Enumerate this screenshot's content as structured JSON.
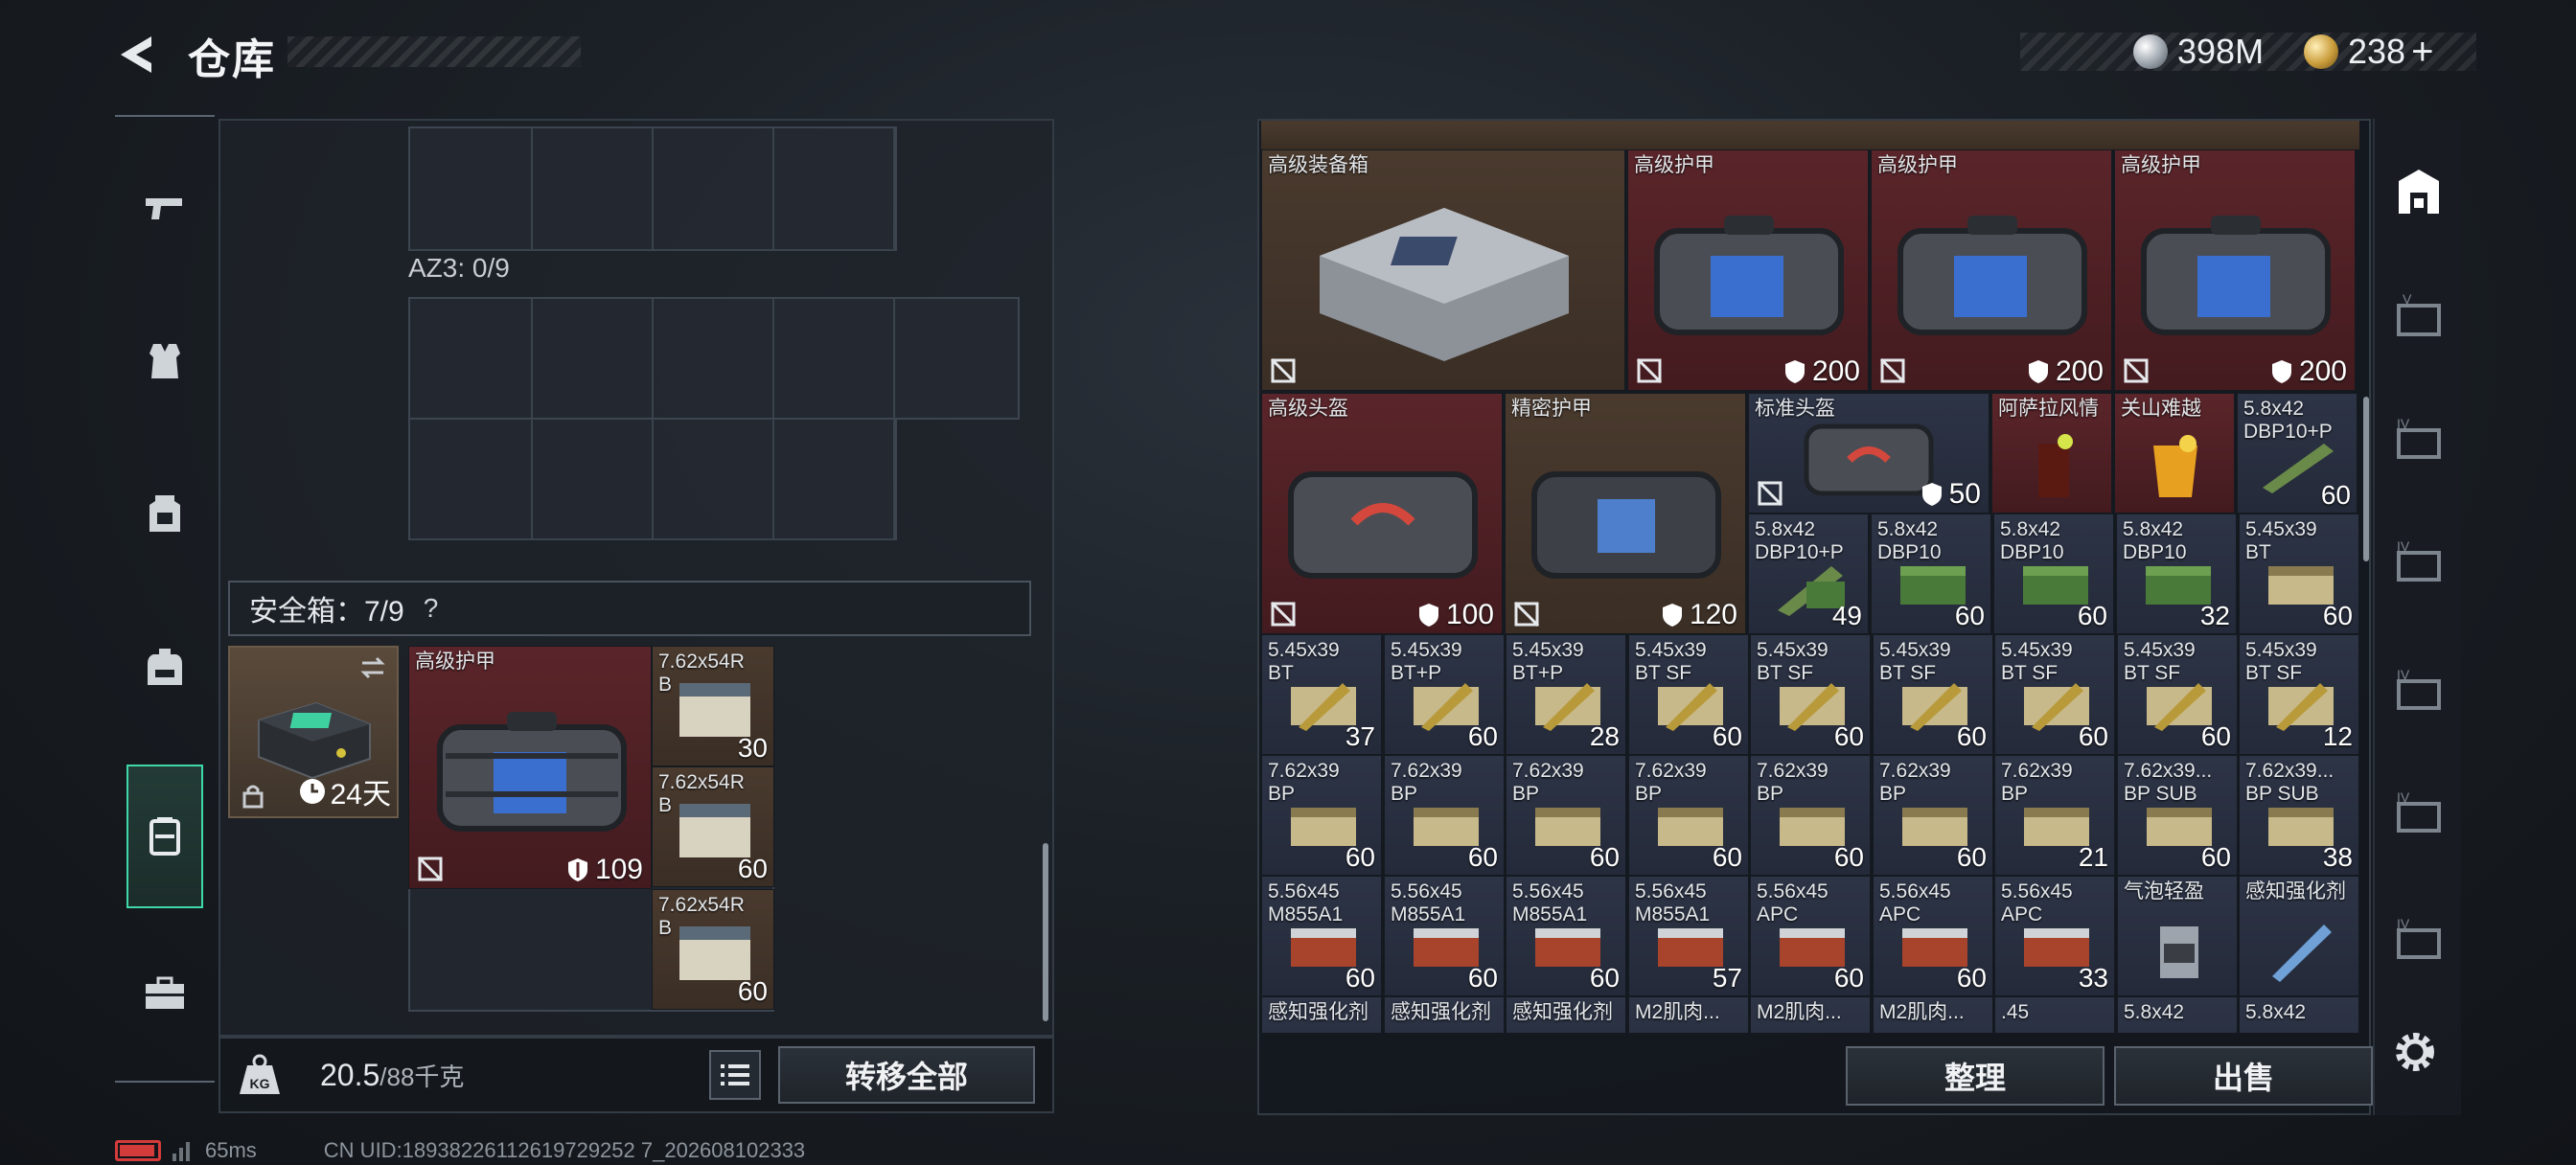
{
  "header": {
    "title": "仓库",
    "currency_silver": "398M",
    "currency_gold": "238",
    "currency_plus": "+"
  },
  "left_sidebar": {
    "items": [
      {
        "name": "weapons",
        "icon": "pistol-icon"
      },
      {
        "name": "armor",
        "icon": "vest-icon"
      },
      {
        "name": "chest-rig",
        "icon": "chest-rig-icon"
      },
      {
        "name": "backpack",
        "icon": "backpack-icon"
      },
      {
        "name": "safe-box",
        "icon": "safe-case-icon",
        "active": true
      },
      {
        "name": "toolbox",
        "icon": "briefcase-icon"
      }
    ]
  },
  "left_panel": {
    "az3_label": "AZ3: 0/9",
    "safebox_label": "安全箱：7/9",
    "help": "?",
    "safebox_timer": "24天",
    "weight_current": "20.5",
    "weight_capacity": "/88千克",
    "transfer_all": "转移全部",
    "items": {
      "armor": {
        "name": "高级护甲",
        "durability": "109"
      },
      "ammo1": {
        "name": "7.62x54R\nB",
        "count": "30"
      },
      "ammo2": {
        "name": "7.62x54R\nB",
        "count": "60"
      },
      "ammo3": {
        "name": "7.62x54R\nB",
        "count": "60"
      }
    }
  },
  "stash": {
    "big": [
      {
        "name": "高级装备箱",
        "value": ""
      },
      {
        "name": "高级护甲",
        "value": "200"
      },
      {
        "name": "高级护甲",
        "value": "200"
      },
      {
        "name": "高级护甲",
        "value": "200"
      },
      {
        "name": "高级头盔",
        "value": "100"
      },
      {
        "name": "精密护甲",
        "value": "120"
      },
      {
        "name": "标准头盔",
        "value": "50"
      }
    ],
    "row_a": [
      {
        "name": "阿萨拉风情",
        "count": ""
      },
      {
        "name": "关山难越",
        "count": ""
      },
      {
        "name": "5.8x42\nDBP10+P",
        "count": "60"
      }
    ],
    "row_b": [
      {
        "name": "5.8x42\nDBP10+P",
        "count": "49"
      },
      {
        "name": "5.8x42\nDBP10",
        "count": "60"
      },
      {
        "name": "5.8x42\nDBP10",
        "count": "60"
      },
      {
        "name": "5.8x42\nDBP10",
        "count": "32"
      },
      {
        "name": "5.45x39\nBT",
        "count": "60"
      }
    ],
    "row_c": [
      {
        "name": "5.45x39\nBT",
        "count": "37"
      },
      {
        "name": "5.45x39\nBT+P",
        "count": "60"
      },
      {
        "name": "5.45x39\nBT+P",
        "count": "28"
      },
      {
        "name": "5.45x39\nBT SF",
        "count": "60"
      },
      {
        "name": "5.45x39\nBT SF",
        "count": "60"
      },
      {
        "name": "5.45x39\nBT SF",
        "count": "60"
      },
      {
        "name": "5.45x39\nBT SF",
        "count": "60"
      },
      {
        "name": "5.45x39\nBT SF",
        "count": "60"
      },
      {
        "name": "5.45x39\nBT SF",
        "count": "12"
      }
    ],
    "row_d": [
      {
        "name": "7.62x39\nBP",
        "count": "60"
      },
      {
        "name": "7.62x39\nBP",
        "count": "60"
      },
      {
        "name": "7.62x39\nBP",
        "count": "60"
      },
      {
        "name": "7.62x39\nBP",
        "count": "60"
      },
      {
        "name": "7.62x39\nBP",
        "count": "60"
      },
      {
        "name": "7.62x39\nBP",
        "count": "60"
      },
      {
        "name": "7.62x39\nBP",
        "count": "21"
      },
      {
        "name": "7.62x39...\nBP SUB",
        "count": "60"
      },
      {
        "name": "7.62x39...\nBP SUB",
        "count": "38"
      }
    ],
    "row_e": [
      {
        "name": "5.56x45\nM855A1",
        "count": "60"
      },
      {
        "name": "5.56x45\nM855A1",
        "count": "60"
      },
      {
        "name": "5.56x45\nM855A1",
        "count": "60"
      },
      {
        "name": "5.56x45\nM855A1",
        "count": "57"
      },
      {
        "name": "5.56x45\nAPC",
        "count": "60"
      },
      {
        "name": "5.56x45\nAPC",
        "count": "60"
      },
      {
        "name": "5.56x45\nAPC",
        "count": "33"
      },
      {
        "name": "气泡轻盈",
        "count": ""
      },
      {
        "name": "感知强化剂",
        "count": ""
      }
    ],
    "row_f": [
      {
        "name": "感知强化剂"
      },
      {
        "name": "感知强化剂"
      },
      {
        "name": "感知强化剂"
      },
      {
        "name": "M2肌肉..."
      },
      {
        "name": "M2肌肉..."
      },
      {
        "name": "M2肌肉..."
      },
      {
        "name": ".45"
      },
      {
        "name": "5.8x42"
      },
      {
        "name": "5.8x42"
      }
    ]
  },
  "bottom_buttons": {
    "sort": "整理",
    "sell": "出售"
  },
  "right_sidebar": {
    "items": [
      "stash-main-icon",
      "stash-tab-v-icon",
      "stash-tab-iv-icon",
      "stash-tab-iv-icon",
      "stash-tab-iv-icon",
      "stash-tab-iv-icon",
      "stash-tab-iv-icon"
    ]
  },
  "status": {
    "ping": "65ms",
    "uid": "CN UID:18938226112619729252 7_202608102333"
  },
  "colors": {
    "accent": "#3fd8a8",
    "tile_red": "#5a252a",
    "tile_blue": "#2d3446",
    "tile_brown": "#4a3a2e"
  }
}
